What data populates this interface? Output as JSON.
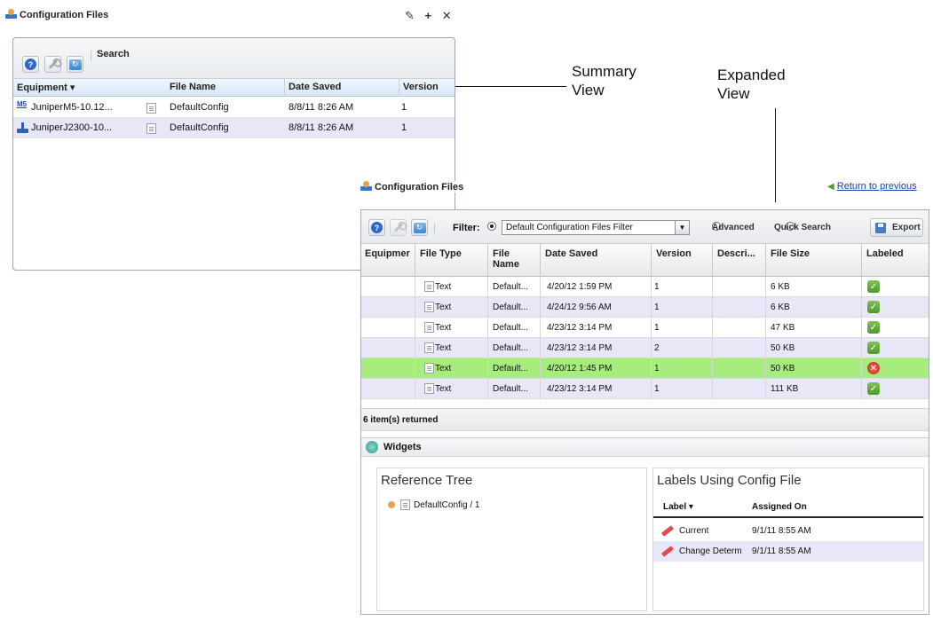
{
  "summary": {
    "title": "Configuration Files",
    "window_controls": {
      "pin": "✎",
      "add": "+",
      "close": "✕"
    },
    "toolbar": {
      "search_label": "Search"
    },
    "columns": [
      "Equipment ▾",
      "File Name",
      "Date Saved",
      "Version"
    ],
    "rows": [
      {
        "equipment": "JuniperM5-10.12...",
        "equipment_badge": "M5",
        "file_name": "DefaultConfig",
        "date_saved": "8/8/11 8:26 AM",
        "version": "1"
      },
      {
        "equipment": "JuniperJ2300-10...",
        "equipment_badge": "",
        "file_name": "DefaultConfig",
        "date_saved": "8/8/11 8:26 AM",
        "version": "1"
      }
    ]
  },
  "callouts": {
    "summary_line1": "Summary",
    "summary_line2": "View",
    "expanded_line1": "Expanded",
    "expanded_line2": "View"
  },
  "expanded": {
    "title": "Configuration Files",
    "return_link": "Return to previous",
    "toolbar": {
      "filter_label": "Filter:",
      "filter_value": "Default Configuration Files Filter",
      "advanced_label": "Advanced",
      "quick_search_label": "Quick Search",
      "export_label": "Export"
    },
    "columns": [
      "Equipmer",
      "File Type",
      "File Name",
      "Date Saved",
      "Version",
      "Descri...",
      "File Size",
      "Labeled"
    ],
    "rows": [
      {
        "file_type": "Text",
        "file_name": "Default...",
        "date_saved": "4/20/12 1:59 PM",
        "version": "1",
        "file_size": "6 KB",
        "labeled": true,
        "highlight": "none"
      },
      {
        "file_type": "Text",
        "file_name": "Default...",
        "date_saved": "4/24/12 9:56 AM",
        "version": "1",
        "file_size": "6 KB",
        "labeled": true,
        "highlight": "alt"
      },
      {
        "file_type": "Text",
        "file_name": "Default...",
        "date_saved": "4/23/12 3:14 PM",
        "version": "1",
        "file_size": "47 KB",
        "labeled": true,
        "highlight": "none"
      },
      {
        "file_type": "Text",
        "file_name": "Default...",
        "date_saved": "4/23/12 3:14 PM",
        "version": "2",
        "file_size": "50 KB",
        "labeled": true,
        "highlight": "alt"
      },
      {
        "file_type": "Text",
        "file_name": "Default...",
        "date_saved": "4/20/12 1:45 PM",
        "version": "1",
        "file_size": "50 KB",
        "labeled": false,
        "highlight": "selected"
      },
      {
        "file_type": "Text",
        "file_name": "Default...",
        "date_saved": "4/23/12 3:14 PM",
        "version": "1",
        "file_size": "111 KB",
        "labeled": true,
        "highlight": "alt"
      }
    ],
    "status": "6 item(s) returned",
    "widgets": {
      "title": "Widgets",
      "reference_tree": {
        "title": "Reference Tree",
        "node": "DefaultConfig / 1"
      },
      "labels": {
        "title": "Labels Using Config File",
        "columns": [
          "Label ▾",
          "Assigned On"
        ],
        "rows": [
          {
            "label": "Current",
            "assigned_on": "9/1/11 8:55 AM"
          },
          {
            "label": "Change Determ",
            "assigned_on": "9/1/11 8:55 AM"
          }
        ]
      }
    }
  },
  "colors": {
    "row_alt": "#e7e7f7",
    "row_selected": "#a6ed7e",
    "link": "#1b3fa8",
    "labeled_ok": "#5aa534",
    "labeled_error": "#d0342a"
  }
}
